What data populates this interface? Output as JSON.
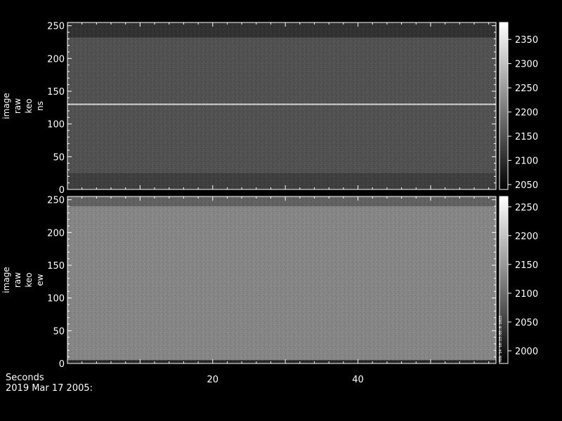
{
  "chart_data": [
    {
      "type": "heatmap",
      "panel": "top",
      "ylabel_lines": [
        "image",
        "raw",
        "keo",
        "ns"
      ],
      "ylim": [
        0,
        255
      ],
      "yticks": [
        0,
        50,
        100,
        150,
        200,
        250
      ],
      "xlim": [
        0,
        59
      ],
      "xticks": [
        20,
        40
      ],
      "colorbar": {
        "min": 2040,
        "max": 2385,
        "ticks": [
          2050,
          2100,
          2150,
          2200,
          2250,
          2300,
          2350
        ]
      },
      "base_level": 2150,
      "features": [
        {
          "kind": "horizontal-line",
          "y": 130,
          "value": 2330
        },
        {
          "kind": "dark-band",
          "y_range": [
            232,
            255
          ],
          "value": 2100
        },
        {
          "kind": "dark-band",
          "y_range": [
            0,
            25
          ],
          "value": 2120
        }
      ]
    },
    {
      "type": "heatmap",
      "panel": "bottom",
      "ylabel_lines": [
        "image",
        "raw",
        "keo",
        "ew"
      ],
      "ylim": [
        0,
        255
      ],
      "yticks": [
        0,
        50,
        100,
        150,
        200,
        250
      ],
      "xlim": [
        0,
        59
      ],
      "xticks": [
        20,
        40
      ],
      "colorbar": {
        "min": 1978,
        "max": 2268,
        "ticks": [
          2000,
          2050,
          2100,
          2150,
          2200,
          2250
        ]
      },
      "colorbar_side_text": "MON 14 10:13:02.0 2023",
      "base_level": 2130,
      "features": [
        {
          "kind": "dark-band",
          "y_range": [
            0,
            5
          ],
          "value": 2000
        },
        {
          "kind": "dark-band",
          "y_range": [
            240,
            255
          ],
          "value": 2080
        }
      ]
    }
  ],
  "xlabel": "Seconds",
  "date_label": "2019 Mar 17 2005:"
}
